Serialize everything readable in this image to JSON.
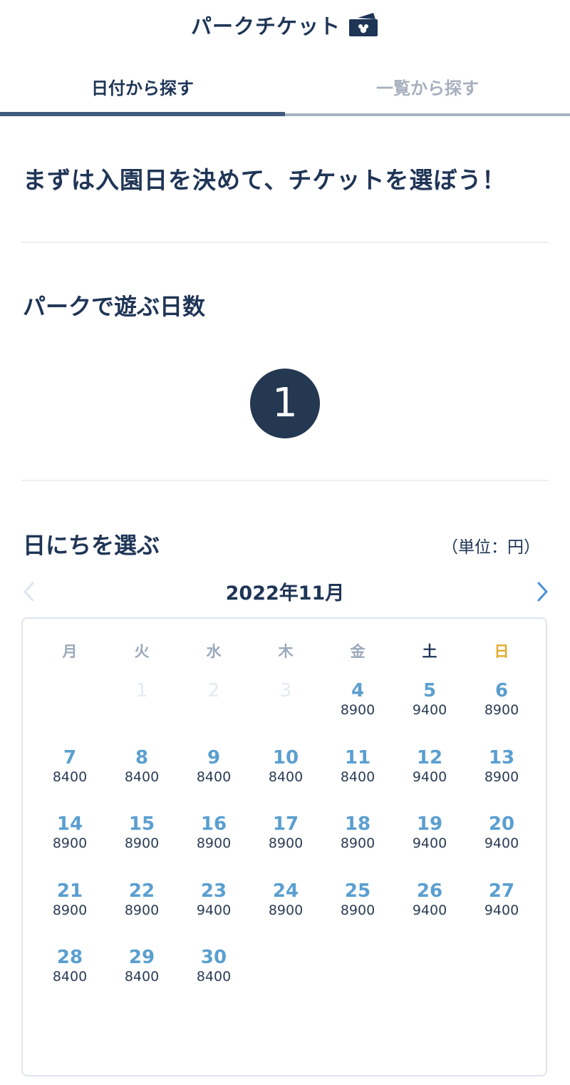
{
  "header": {
    "title": "パークチケット"
  },
  "tabs": [
    {
      "label": "日付から探す",
      "active": true
    },
    {
      "label": "一覧から探す",
      "active": false
    }
  ],
  "lead": "まずは入園日を決めて、チケットを選ぼう！",
  "days_section": {
    "title": "パークで遊ぶ日数",
    "count": "1"
  },
  "date_section": {
    "title": "日にちを選ぶ",
    "unit_note": "（単位：円）"
  },
  "calendar": {
    "month_label": "2022年11月",
    "weekdays": [
      "月",
      "火",
      "水",
      "木",
      "金",
      "土",
      "日"
    ],
    "days": [
      {
        "day": "1",
        "price": "",
        "available": false
      },
      {
        "day": "2",
        "price": "",
        "available": false
      },
      {
        "day": "3",
        "price": "",
        "available": false
      },
      {
        "day": "4",
        "price": "8900",
        "available": true
      },
      {
        "day": "5",
        "price": "9400",
        "available": true
      },
      {
        "day": "6",
        "price": "8900",
        "available": true
      },
      {
        "day": "7",
        "price": "8400",
        "available": true
      },
      {
        "day": "8",
        "price": "8400",
        "available": true
      },
      {
        "day": "9",
        "price": "8400",
        "available": true
      },
      {
        "day": "10",
        "price": "8400",
        "available": true
      },
      {
        "day": "11",
        "price": "8400",
        "available": true
      },
      {
        "day": "12",
        "price": "9400",
        "available": true
      },
      {
        "day": "13",
        "price": "8900",
        "available": true
      },
      {
        "day": "14",
        "price": "8900",
        "available": true
      },
      {
        "day": "15",
        "price": "8900",
        "available": true
      },
      {
        "day": "16",
        "price": "8900",
        "available": true
      },
      {
        "day": "17",
        "price": "8900",
        "available": true
      },
      {
        "day": "18",
        "price": "8900",
        "available": true
      },
      {
        "day": "19",
        "price": "9400",
        "available": true
      },
      {
        "day": "20",
        "price": "9400",
        "available": true
      },
      {
        "day": "21",
        "price": "8900",
        "available": true
      },
      {
        "day": "22",
        "price": "8900",
        "available": true
      },
      {
        "day": "23",
        "price": "9400",
        "available": true
      },
      {
        "day": "24",
        "price": "8900",
        "available": true
      },
      {
        "day": "25",
        "price": "8900",
        "available": true
      },
      {
        "day": "26",
        "price": "9400",
        "available": true
      },
      {
        "day": "27",
        "price": "9400",
        "available": true
      },
      {
        "day": "28",
        "price": "8400",
        "available": true
      },
      {
        "day": "29",
        "price": "8400",
        "available": true
      },
      {
        "day": "30",
        "price": "8400",
        "available": true
      }
    ]
  },
  "icons": {
    "header": "ticket-icon",
    "prev": "chevron-left-icon",
    "next": "chevron-right-icon"
  },
  "colors": {
    "navy": "#1f3556",
    "accent_blue": "#5b9fd0",
    "sunday": "#e2ab2c",
    "badge_bg": "#253852",
    "next_arrow": "#4a90d9"
  }
}
